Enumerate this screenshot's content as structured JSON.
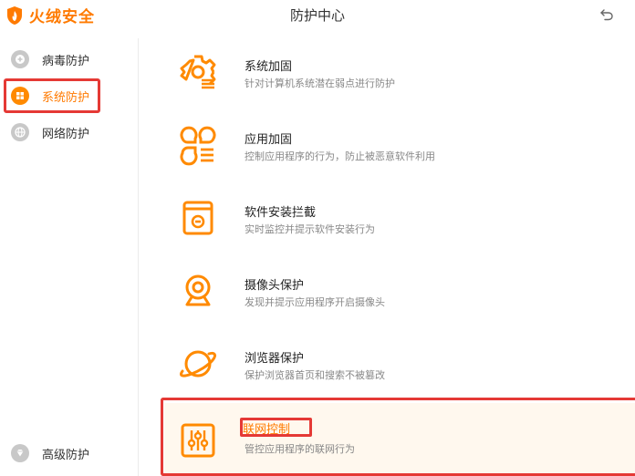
{
  "app": {
    "logo_text": "火绒安全",
    "window_title": "防护中心",
    "back_icon": "back-arrow-icon"
  },
  "sidebar": {
    "items": [
      {
        "label": "病毒防护",
        "icon": "plus-circle-icon",
        "active": false
      },
      {
        "label": "系统防护",
        "icon": "windows-icon",
        "active": true
      },
      {
        "label": "网络防护",
        "icon": "globe-icon",
        "active": false
      },
      {
        "label": "高级防护",
        "icon": "diamond-icon",
        "active": false
      }
    ]
  },
  "features": [
    {
      "title": "系统加固",
      "desc": "针对计算机系统潜在弱点进行防护",
      "icon": "gear-shield-icon"
    },
    {
      "title": "应用加固",
      "desc": "控制应用程序的行为，防止被恶意软件利用",
      "icon": "app-grid-icon"
    },
    {
      "title": "软件安装拦截",
      "desc": "实时监控并提示软件安装行为",
      "icon": "install-block-icon"
    },
    {
      "title": "摄像头保护",
      "desc": "发现并提示应用程序开启摄像头",
      "icon": "webcam-icon"
    },
    {
      "title": "浏览器保护",
      "desc": "保护浏览器首页和搜索不被篡改",
      "icon": "planet-icon"
    },
    {
      "title": "联网控制",
      "desc": "管控应用程序的联网行为",
      "icon": "sliders-icon"
    }
  ],
  "colors": {
    "accent": "#ff7a00",
    "highlight": "#e53935",
    "grey": "#bdbdbd"
  }
}
